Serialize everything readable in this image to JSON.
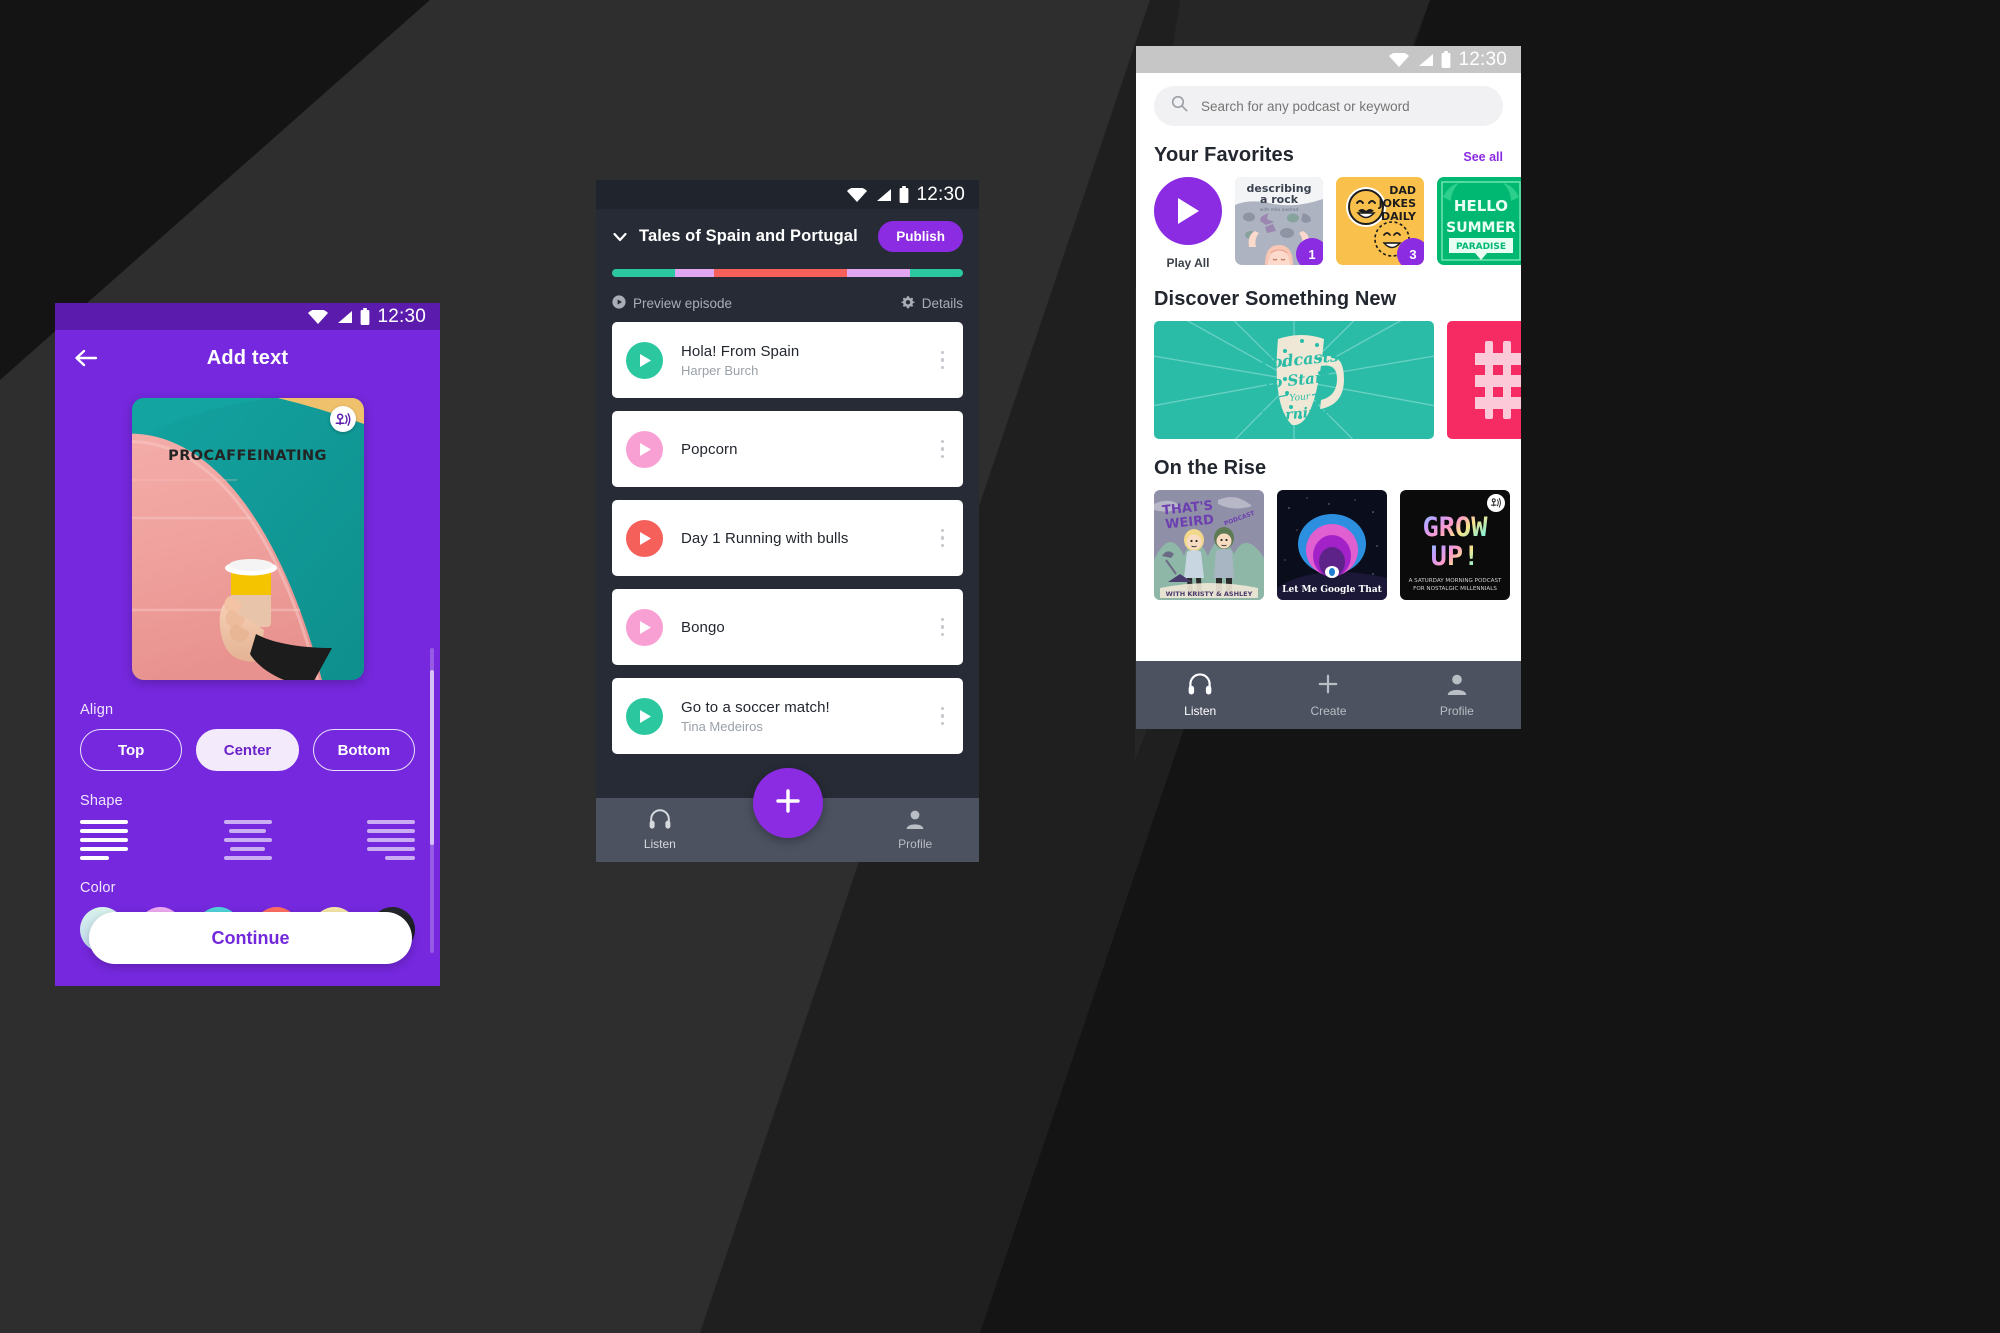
{
  "background": {
    "base_color": "#1c1c1c",
    "panel_dark": "#141414",
    "panel_mid": "#303030",
    "panel_light": "#3a3a3a"
  },
  "colors": {
    "purple": "#7528DD",
    "purple_bright": "#8B2BE2",
    "purple_status": "#5B1CAE",
    "teal": "#2BC8A0",
    "pink": "#F89FD4",
    "coral": "#F5605A",
    "lilac": "#E0A6F2",
    "dark_panel": "#262B35",
    "nav_gray": "#4C5260"
  },
  "phone1": {
    "statusbar": {
      "time": "12:30",
      "icons": [
        "wifi-icon",
        "signal-icon",
        "battery-icon"
      ]
    },
    "appbar": {
      "back_icon": "back-arrow-icon",
      "title": "Add text"
    },
    "artwork": {
      "title": "PROCAFFEINATING",
      "badge_icon": "anchor-podcast-icon"
    },
    "align": {
      "label": "Align",
      "options": [
        "Top",
        "Center",
        "Bottom"
      ],
      "selected": "Center"
    },
    "shape": {
      "label": "Shape",
      "options": [
        {
          "name": "shape-left-align",
          "selected": true,
          "widths": [
            100,
            100,
            100,
            100,
            60
          ]
        },
        {
          "name": "shape-center-align",
          "selected": false,
          "widths": [
            100,
            78,
            100,
            72,
            100
          ]
        },
        {
          "name": "shape-right-align",
          "selected": false,
          "widths": [
            100,
            100,
            100,
            100,
            62
          ]
        }
      ]
    },
    "color": {
      "label": "Color",
      "swatches": [
        {
          "name": "swatch-mint",
          "from": "#D9F2EC",
          "to": "#BFD9EE"
        },
        {
          "name": "swatch-lilac",
          "from": "#EFA9F2",
          "to": "#D9A8F0"
        },
        {
          "name": "swatch-cyan",
          "from": "#4FD5D8",
          "to": "#5EB9DE"
        },
        {
          "name": "swatch-coral",
          "from": "#FF7062",
          "to": "#F3575F"
        },
        {
          "name": "swatch-yellow",
          "from": "#F7E8A8",
          "to": "#E6D6BE"
        },
        {
          "name": "swatch-black",
          "from": "#25282E",
          "to": "#11131A"
        }
      ]
    },
    "continue_label": "Continue"
  },
  "phone2": {
    "statusbar": {
      "time": "12:30",
      "icons": [
        "wifi-icon",
        "signal-icon",
        "battery-icon"
      ]
    },
    "header": {
      "chevron_icon": "chevron-down-icon",
      "title": "Tales of Spain and Portugal",
      "publish_label": "Publish"
    },
    "progress_segments": [
      {
        "color": "#2BC8A0",
        "pct": 18
      },
      {
        "color": "#E0A6F2",
        "pct": 11
      },
      {
        "color": "#F5605A",
        "pct": 38
      },
      {
        "color": "#E0A6F2",
        "pct": 18
      },
      {
        "color": "#2BC8A0",
        "pct": 15
      }
    ],
    "actions": {
      "preview_icon": "play-circle-icon",
      "preview_label": "Preview episode",
      "details_icon": "gear-icon",
      "details_label": "Details"
    },
    "episodes": [
      {
        "title": "Hola! From Spain",
        "author": "Harper Burch",
        "color": "#2BC8A0"
      },
      {
        "title": "Popcorn",
        "author": "",
        "color": "#F89FD4"
      },
      {
        "title": "Day 1 Running with bulls",
        "author": "",
        "color": "#F5605A"
      },
      {
        "title": "Bongo",
        "author": "",
        "color": "#F89FD4"
      },
      {
        "title": "Go to a soccer match!",
        "author": "Tina Medeiros",
        "color": "#2BC8A0"
      }
    ],
    "fab_icon": "plus-icon",
    "nav": [
      {
        "icon": "headphones-icon",
        "label": "Listen"
      },
      {
        "icon": "person-icon",
        "label": "Profile"
      }
    ]
  },
  "phone3": {
    "statusbar": {
      "time": "12:30",
      "icons": [
        "wifi-icon",
        "signal-icon",
        "battery-icon"
      ]
    },
    "search": {
      "icon": "search-icon",
      "placeholder": "Search for any podcast or keyword",
      "value": ""
    },
    "favorites": {
      "title": "Your Favorites",
      "see_all": "See all",
      "play_all_label": "Play All",
      "cards": [
        {
          "name": "describing-a-rock",
          "title": "describing a rock",
          "subtitle": "with milo axelrod",
          "badge": "1"
        },
        {
          "name": "dad-jokes-daily",
          "title": "DAD JOKES DAILY",
          "subtitle": "",
          "badge": "3"
        },
        {
          "name": "hello-summer-paradise",
          "title": "HELLO SUMMER PARADISE",
          "subtitle": "",
          "badge": ""
        }
      ]
    },
    "discover": {
      "title": "Discover Something New",
      "cards": [
        {
          "name": "podcasts-to-start-your-mornings",
          "line1": "Podcasts",
          "line2": "to Start",
          "line3": "Your",
          "line4": "Mornings."
        },
        {
          "name": "bitcoin-card",
          "line1": "₿"
        }
      ]
    },
    "rise": {
      "title": "On the Rise",
      "cards": [
        {
          "name": "thats-weird",
          "title": "THAT'S WEIRD",
          "caption": "WITH KRISTY & ASHLEY"
        },
        {
          "name": "let-me-google-that",
          "title": "Let Me Google That",
          "caption": ""
        },
        {
          "name": "grow-up",
          "title": "GROW UP!",
          "caption": "A SATURDAY MORNING PODCAST FOR NOSTALGIC MILLENNIALS"
        }
      ]
    },
    "nav": [
      {
        "icon": "headphones-icon",
        "label": "Listen",
        "active": true
      },
      {
        "icon": "plus-icon",
        "label": "Create",
        "active": false
      },
      {
        "icon": "person-icon",
        "label": "Profile",
        "active": false
      }
    ]
  }
}
